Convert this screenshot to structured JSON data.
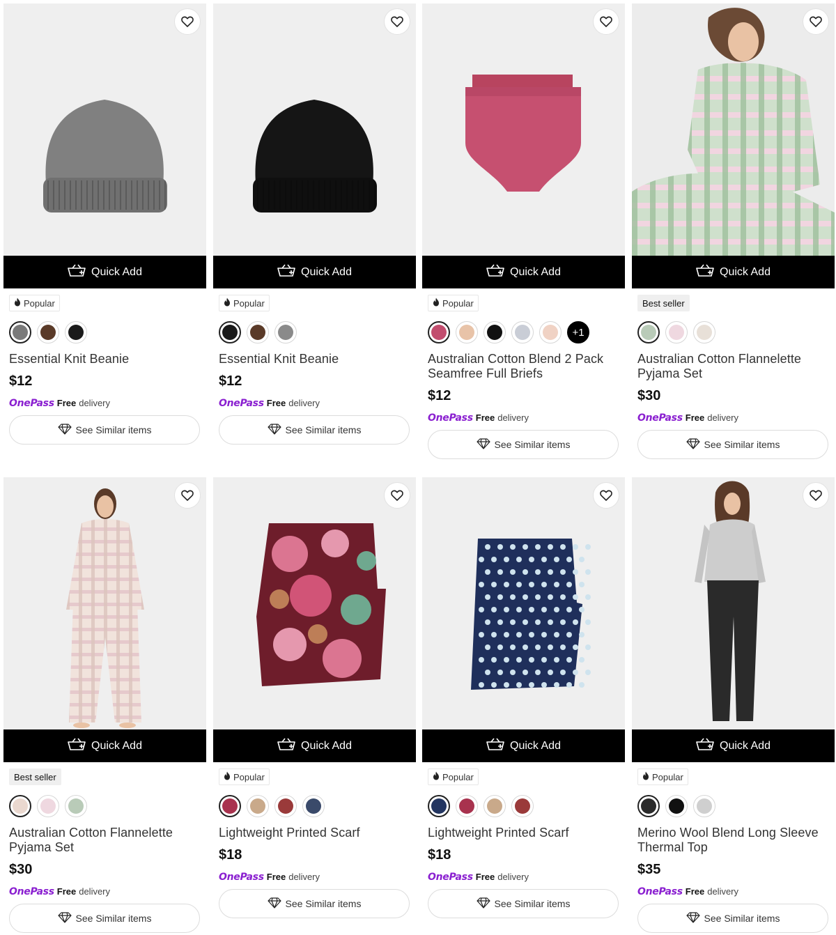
{
  "quick_add_label": "Quick Add",
  "see_similar_label": "See Similar items",
  "onepass_brand": "OnePass",
  "free_label": "Free",
  "delivery_label": "delivery",
  "products": [
    {
      "badge": "Popular",
      "badge_type": "popular",
      "name": "Essential Knit Beanie",
      "price": "$12",
      "image": "grey-beanie",
      "swatches": [
        "#7a7a7a",
        "#5a3a28",
        "#1a1a1a"
      ],
      "selected": 0,
      "more": ""
    },
    {
      "badge": "Popular",
      "badge_type": "popular",
      "name": "Essential Knit Beanie",
      "price": "$12",
      "image": "black-beanie",
      "swatches": [
        "#1a1a1a",
        "#5a3a28",
        "#8a8a8a"
      ],
      "selected": 0,
      "more": ""
    },
    {
      "badge": "Popular",
      "badge_type": "popular",
      "name": "Australian Cotton Blend 2 Pack Seamfree Full Briefs",
      "price": "$12",
      "image": "pink-briefs",
      "swatches": [
        "#c24d6e",
        "#e8c3a8",
        "#111111",
        "#c9cdd6",
        "#f0d2c4"
      ],
      "selected": 0,
      "more": "+1"
    },
    {
      "badge": "Best seller",
      "badge_type": "best",
      "name": "Australian Cotton Flannelette Pyjama Set",
      "price": "$30",
      "image": "green-pyjamas",
      "swatches": [
        "#b9cbb8",
        "#efd8e0",
        "#e8e0d8"
      ],
      "selected": 0,
      "more": ""
    },
    {
      "badge": "Best seller",
      "badge_type": "best",
      "name": "Australian Cotton Flannelette Pyjama Set",
      "price": "$30",
      "image": "pink-pyjamas",
      "swatches": [
        "#ead8cf",
        "#efd8e0",
        "#b9cbb8"
      ],
      "selected": 0,
      "more": ""
    },
    {
      "badge": "Popular",
      "badge_type": "popular",
      "name": "Lightweight Printed Scarf",
      "price": "$18",
      "image": "floral-scarf",
      "swatches": [
        "#a8324e",
        "#c9a98a",
        "#9a3a3a",
        "#3a4a6a"
      ],
      "selected": 0,
      "more": ""
    },
    {
      "badge": "Popular",
      "badge_type": "popular",
      "name": "Lightweight Printed Scarf",
      "price": "$18",
      "image": "polka-scarf",
      "swatches": [
        "#233560",
        "#a8324e",
        "#c9a98a",
        "#9a3a3a"
      ],
      "selected": 0,
      "more": ""
    },
    {
      "badge": "Popular",
      "badge_type": "popular",
      "name": "Merino Wool Blend Long Sleeve Thermal Top",
      "price": "$35",
      "image": "grey-thermal",
      "swatches": [
        "#2a2a2a",
        "#111111",
        "#cfcfcf"
      ],
      "selected": 0,
      "more": ""
    }
  ],
  "colors": {
    "onepass": "#8a1fd0",
    "quick_add_bg": "#000000",
    "image_bg": "#efefef"
  }
}
